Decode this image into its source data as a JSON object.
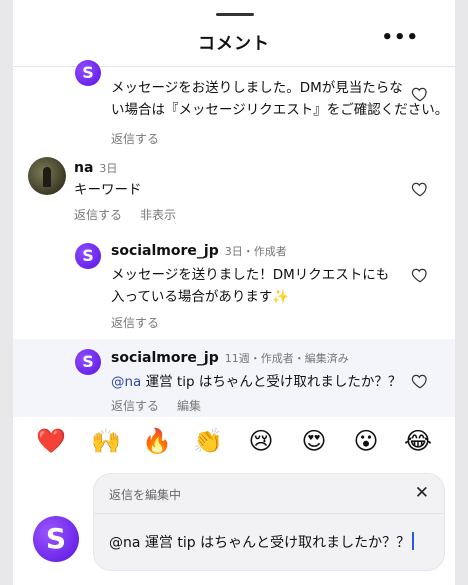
{
  "header": {
    "title": "コメント",
    "more_label": "•••"
  },
  "comments": [
    {
      "username": "",
      "meta": "",
      "text_line1": "メッセージをお送りしました。DMが見当たらな",
      "text_line2": "い場合は『メッセージリクエスト』をご確認ください。",
      "actions": [
        "返信する"
      ]
    },
    {
      "username": "na",
      "meta": "3日",
      "text_line1": "キーワード",
      "actions": [
        "返信する",
        "非表示"
      ]
    },
    {
      "username": "socialmore_jp",
      "meta": "3日・作成者",
      "text_line1": "メッセージを送りました！DMリクエストにも",
      "text_line2": "入っている場合があります✨",
      "actions": [
        "返信する"
      ]
    },
    {
      "username": "socialmore_jp",
      "meta": "11週・作成者・編集済み",
      "mention": "@na",
      "text_line1": " 運営 tip はちゃんと受け取れましたか？？",
      "actions": [
        "返信する",
        "編集"
      ]
    }
  ],
  "avatar_letter": "S",
  "emoji_bar": [
    "❤️",
    "🙌",
    "🔥",
    "👏",
    "😢",
    "😍",
    "😮",
    "😂"
  ],
  "editor": {
    "label": "返信を編集中",
    "close_label": "✕",
    "value": "@na 運営 tip はちゃんと受け取れましたか？？"
  },
  "colors": {
    "accent": "#5a14e0",
    "mention": "#2e4a9e",
    "highlight_bg": "#f4f5fb"
  }
}
